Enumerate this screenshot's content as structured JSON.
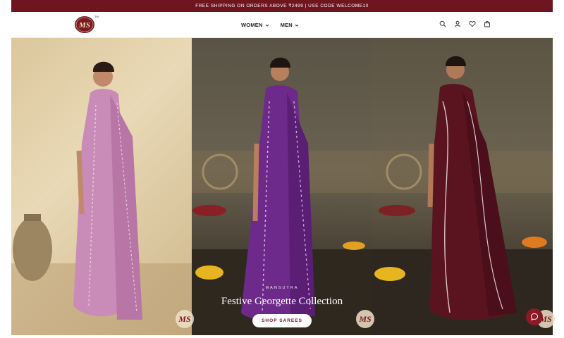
{
  "announcement": "FREE SHIPPING ON ORDERS ABOVE ₹2499 | USE CODE WELCOME10",
  "logo": {
    "text": "MS",
    "tm": "TM"
  },
  "nav": [
    {
      "label": "WOMEN",
      "icon": "chevron-down-icon"
    },
    {
      "label": "MEN",
      "icon": "chevron-down-icon"
    }
  ],
  "header_icons": [
    "search-icon",
    "user-icon",
    "heart-icon",
    "bag-icon"
  ],
  "hero": {
    "kicker": "MANSUTRA",
    "title": "Festive Georgette Collection",
    "cta": "SHOP SAREES",
    "panel_logo": "MS"
  },
  "colors": {
    "brand": "#6e1520",
    "saree_pink": "#c98bb8",
    "saree_purple": "#6e2a8a",
    "saree_maroon": "#5a1420"
  }
}
